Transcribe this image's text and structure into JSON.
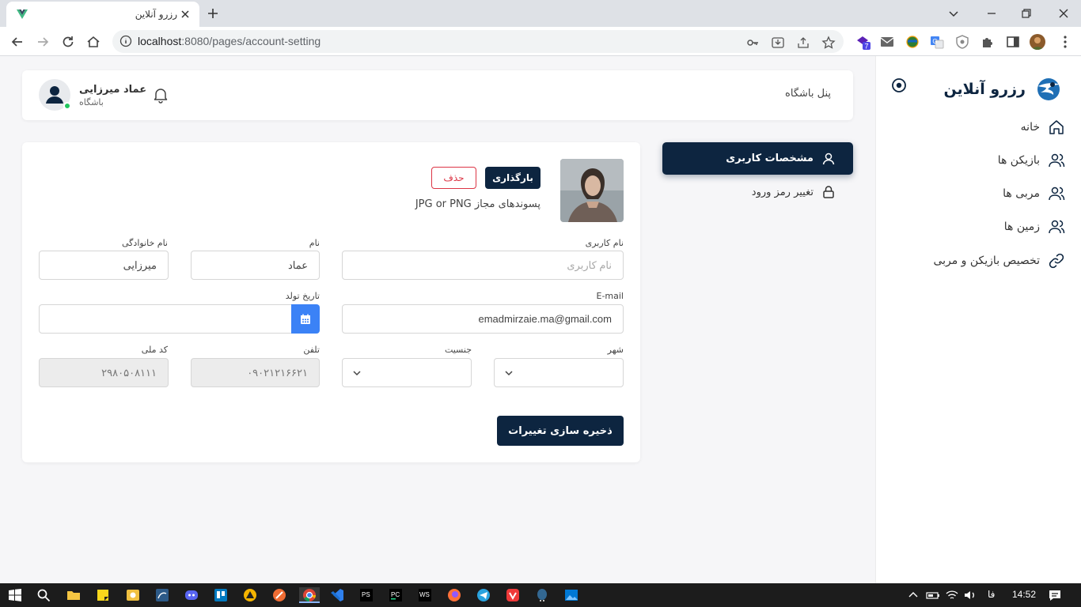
{
  "browser": {
    "tab_title": "رزرو آنلاین",
    "url_host": "localhost",
    "url_path": ":8080/pages/account-setting",
    "extension_badge": "7"
  },
  "sidebar": {
    "brand": "رزرو آنلاین",
    "items": [
      {
        "label": "خانه",
        "icon": "home-icon"
      },
      {
        "label": "بازیکن ها",
        "icon": "users-icon"
      },
      {
        "label": "مربی ها",
        "icon": "users-icon"
      },
      {
        "label": "زمین ها",
        "icon": "users-icon"
      },
      {
        "label": "تخصیص بازیکن و مربی",
        "icon": "link-icon"
      }
    ]
  },
  "header": {
    "page_title": "پنل باشگاه",
    "user_name": "عماد میرزایی",
    "user_role": "باشگاه"
  },
  "settings_menu": {
    "profile": "مشخصات کاربری",
    "change_password": "تغییر رمز ورود"
  },
  "profile": {
    "upload_label": "بارگذاری",
    "remove_label": "حذف",
    "allowed_hint": "پسوندهای مجاز JPG or PNG"
  },
  "form": {
    "username_label": "نام کاربری",
    "username_placeholder": "نام کاربری",
    "first_name_label": "نام",
    "first_name_value": "عماد",
    "last_name_label": "نام خانوادگی",
    "last_name_value": "میرزایی",
    "email_label": "E-mail",
    "email_value": "emadmirzaie.ma@gmail.com",
    "birth_label": "تاریخ تولد",
    "birth_value": "",
    "city_label": "شهر",
    "gender_label": "جنسیت",
    "phone_label": "تلفن",
    "phone_value": "۰۹۰۲۱۲۱۶۶۲۱",
    "national_code_label": "کد ملی",
    "national_code_value": "۲۹۸۰۵۰۸۱۱۱",
    "save_label": "ذخیره سازی تغییرات"
  },
  "taskbar": {
    "language": "فا",
    "time": "14:52"
  },
  "colors": {
    "primary": "#0d2540",
    "accent": "#3b82f6",
    "danger": "#dc3545",
    "online": "#22c55e"
  }
}
